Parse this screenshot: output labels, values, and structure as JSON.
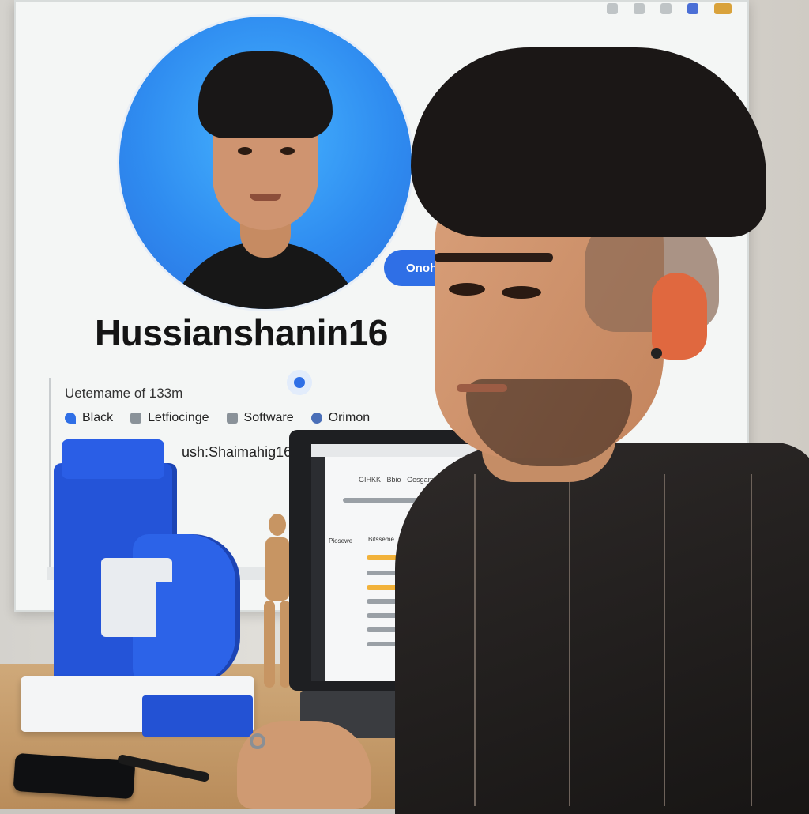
{
  "profile": {
    "follow_button": "Onoho",
    "username": "Hussianshanin16",
    "meta_line": "Uetemame of 133m",
    "tags": [
      {
        "icon": "pin-icon",
        "label": "Black"
      },
      {
        "icon": "tag-icon",
        "label": "Letfiocinge"
      },
      {
        "icon": "dots-icon",
        "label": "Software"
      },
      {
        "icon": "chat-icon",
        "label": "Orimon"
      }
    ],
    "handle": "ush:Shaimahig16"
  },
  "laptop": {
    "header_labels": [
      "GIHKK",
      "Bbio",
      "Gesgamolo"
    ],
    "section_labels": [
      "Piosewe",
      "Bitsseme"
    ]
  },
  "colors": {
    "accent": "#2f6fe6",
    "logo_blue": "#2454d8",
    "avatar_bg": "#2f8cf0"
  }
}
